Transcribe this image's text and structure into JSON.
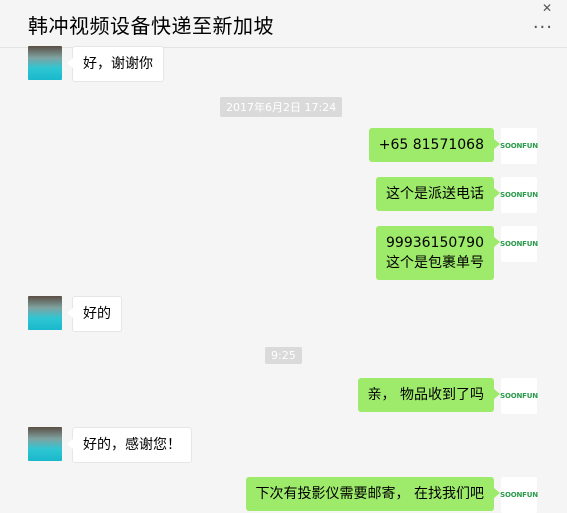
{
  "window": {
    "title": "韩冲视频设备快递至新加坡",
    "close_glyph": "✕",
    "more_glyph": "···"
  },
  "contact_avatar_icon": "contact-avatar-icon",
  "my_avatar": {
    "text": "SOONFUN",
    "icon": "soonfun-logo-icon"
  },
  "messages": [
    {
      "side": "left",
      "text": "好，谢谢你"
    },
    {
      "type": "time",
      "text": "2017年6月2日 17:24"
    },
    {
      "side": "right",
      "text": "+65 81571068"
    },
    {
      "side": "right",
      "text": "这个是派送电话"
    },
    {
      "side": "right",
      "line1": "99936150790",
      "line2": "这个是包裹单号"
    },
    {
      "side": "left",
      "text": "好的"
    },
    {
      "type": "time",
      "text": "9:25"
    },
    {
      "side": "right",
      "text": "亲，  物品收到了吗"
    },
    {
      "side": "left",
      "text": "好的，感谢您！"
    },
    {
      "side": "right",
      "text": "下次有投影仪需要邮寄，  在找我们吧"
    }
  ]
}
